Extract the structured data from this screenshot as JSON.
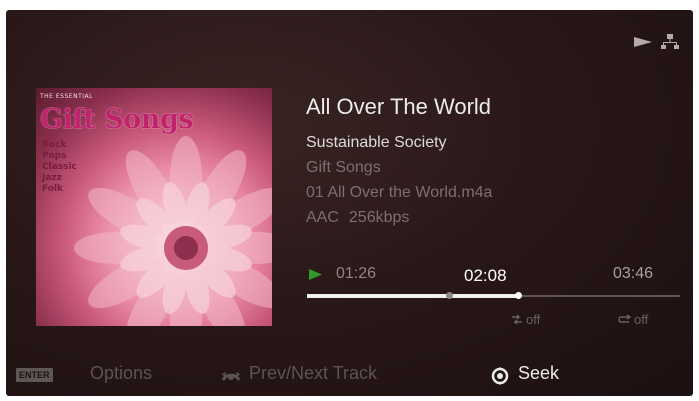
{
  "track": {
    "title": "All Over The World",
    "artist": "Sustainable Society",
    "album": "Gift Songs",
    "file": "01 All Over the World.m4a",
    "codec": "AAC",
    "bitrate": "256kbps"
  },
  "album_art": {
    "series": "THE ESSENTIAL",
    "title": "Gift Songs",
    "genres": [
      "Rock",
      "Pops",
      "Classic",
      "Jazz",
      "Folk"
    ]
  },
  "playback": {
    "state": "play",
    "elapsed": "01:26",
    "seek_position": "02:08",
    "total": "03:46",
    "elapsed_fraction": 0.381,
    "seek_fraction": 0.566
  },
  "modes": {
    "shuffle": "off",
    "repeat": "off"
  },
  "footer": {
    "enter_key": "ENTER",
    "options_label": "Options",
    "prev_next_label": "Prev/Next Track",
    "seek_label": "Seek"
  },
  "colors": {
    "play_green": "#2f9a2a",
    "active_text": "#ececec",
    "dim_text": "#5c5454"
  },
  "icons": {
    "status_play": "play-triangle-icon",
    "status_network": "network-icon",
    "shuffle": "shuffle-icon",
    "repeat": "repeat-icon",
    "options_key": "enter-key-icon",
    "prev_next": "dpad-left-right-icon",
    "seek": "dpad-up-down-icon"
  }
}
